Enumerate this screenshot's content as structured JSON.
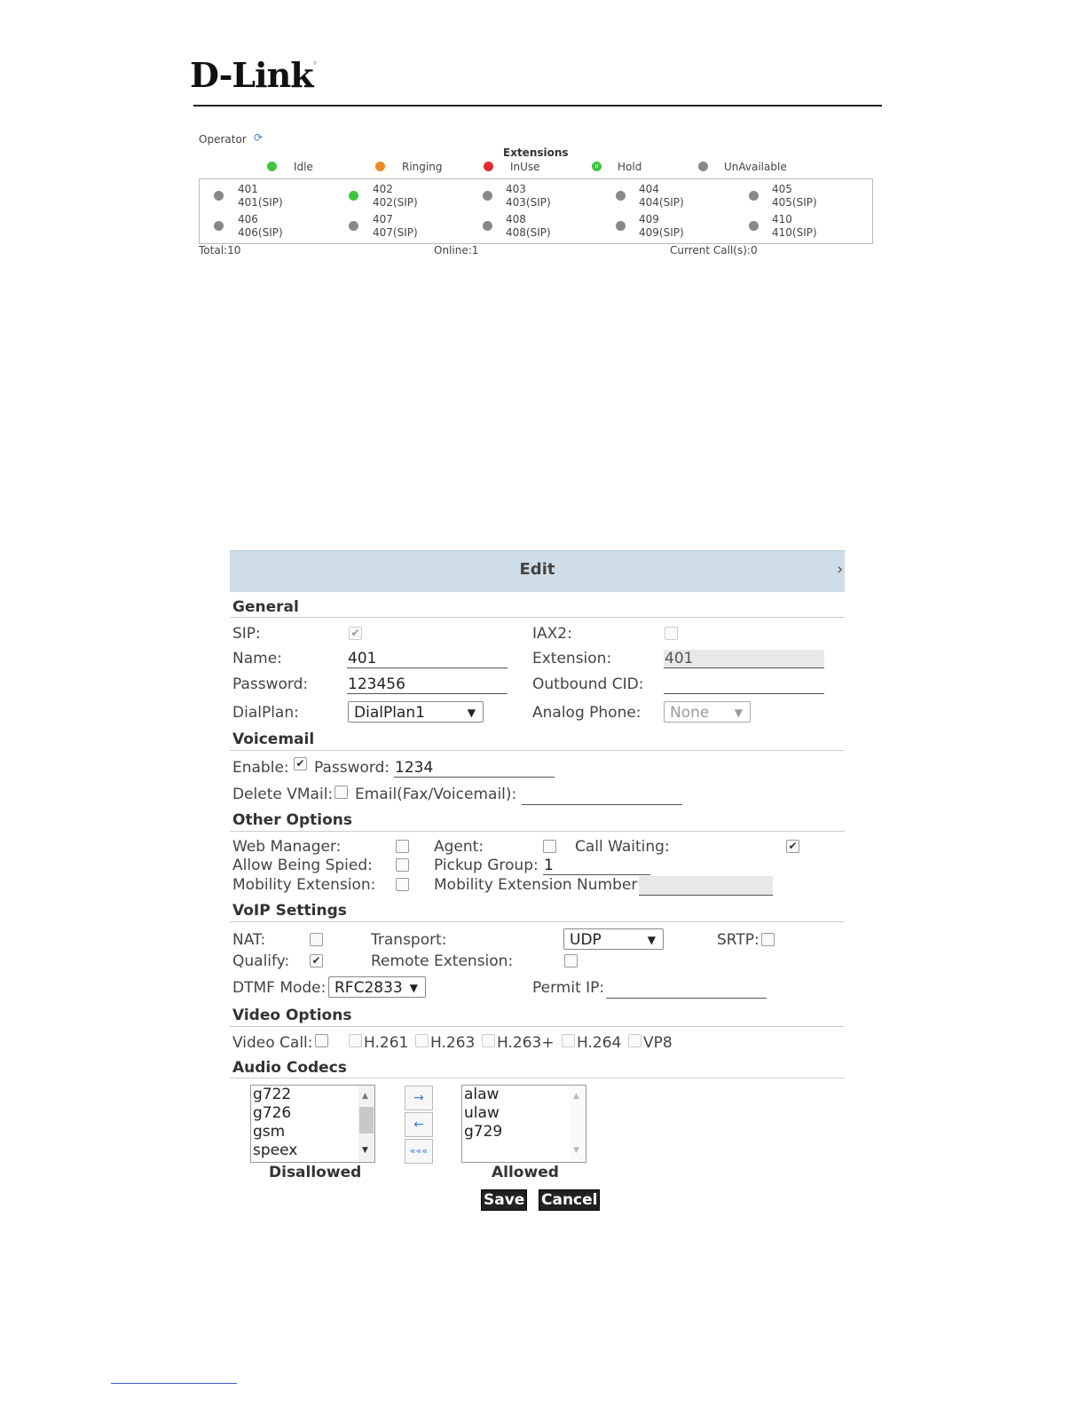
{
  "header": {
    "logo": "D-Link",
    "logo_reg": "®"
  },
  "operator": {
    "label": "Operator",
    "extensions_title": "Extensions",
    "legend": [
      {
        "label": "Idle",
        "color": "#3fc43f"
      },
      {
        "label": "Ringing",
        "color": "#f08a24"
      },
      {
        "label": "InUse",
        "color": "#e02c2c"
      },
      {
        "label": "Hold",
        "color": "#3fc43f"
      },
      {
        "label": "UnAvailable",
        "color": "#888888"
      }
    ],
    "extensions": [
      {
        "num": "401",
        "sip": "401(SIP)",
        "status": "unavailable"
      },
      {
        "num": "402",
        "sip": "402(SIP)",
        "status": "idle"
      },
      {
        "num": "403",
        "sip": "403(SIP)",
        "status": "unavailable"
      },
      {
        "num": "404",
        "sip": "404(SIP)",
        "status": "unavailable"
      },
      {
        "num": "405",
        "sip": "405(SIP)",
        "status": "unavailable"
      },
      {
        "num": "406",
        "sip": "406(SIP)",
        "status": "unavailable"
      },
      {
        "num": "407",
        "sip": "407(SIP)",
        "status": "unavailable"
      },
      {
        "num": "408",
        "sip": "408(SIP)",
        "status": "unavailable"
      },
      {
        "num": "409",
        "sip": "409(SIP)",
        "status": "unavailable"
      },
      {
        "num": "410",
        "sip": "410(SIP)",
        "status": "unavailable"
      }
    ],
    "footer": {
      "total": "Total:10",
      "online": "Online:1",
      "calls": "Current Call(s):0"
    }
  },
  "edit": {
    "title": "Edit",
    "close": "›",
    "general": {
      "heading": "General",
      "sip_label": "SIP:",
      "sip_checked": true,
      "iax2_label": "IAX2:",
      "iax2_checked": false,
      "name_label": "Name:",
      "name_value": "401",
      "extension_label": "Extension:",
      "extension_value": "401",
      "password_label": "Password:",
      "password_value": "123456",
      "outbound_cid_label": "Outbound CID:",
      "outbound_cid_value": "",
      "dialplan_label": "DialPlan:",
      "dialplan_value": "DialPlan1",
      "analog_phone_label": "Analog Phone:",
      "analog_phone_value": "None"
    },
    "voicemail": {
      "heading": "Voicemail",
      "enable_label": "Enable:",
      "enable_checked": true,
      "password_label": "Password:",
      "password_value": "1234",
      "delete_label": "Delete VMail:",
      "delete_checked": false,
      "email_label": "Email(Fax/Voicemail):",
      "email_value": ""
    },
    "other": {
      "heading": "Other Options",
      "web_manager_label": "Web Manager:",
      "agent_label": "Agent:",
      "call_waiting_label": "Call Waiting:",
      "call_waiting_checked": true,
      "allow_spied_label": "Allow Being Spied:",
      "pickup_group_label": "Pickup Group:",
      "pickup_group_value": "1",
      "mobility_ext_label": "Mobility Extension:",
      "mobility_ext_number_label": "Mobility Extension Number:",
      "mobility_ext_number_value": ""
    },
    "voip": {
      "heading": "VoIP Settings",
      "nat_label": "NAT:",
      "transport_label": "Transport:",
      "transport_value": "UDP",
      "srtp_label": "SRTP:",
      "qualify_label": "Qualify:",
      "qualify_checked": true,
      "remote_ext_label": "Remote Extension:",
      "dtmf_label": "DTMF Mode:",
      "dtmf_value": "RFC2833",
      "permit_ip_label": "Permit IP:",
      "permit_ip_value": ""
    },
    "video": {
      "heading": "Video Options",
      "video_call_label": "Video Call:",
      "codecs": [
        "H.261",
        "H.263",
        "H.263+",
        "H.264",
        "VP8"
      ]
    },
    "audio": {
      "heading": "Audio Codecs",
      "disallowed": [
        "g722",
        "g726",
        "gsm",
        "speex"
      ],
      "allowed": [
        "alaw",
        "ulaw",
        "g729"
      ],
      "disallowed_label": "Disallowed",
      "allowed_label": "Allowed",
      "move_right": "→",
      "move_left": "←",
      "move_all_left": "«««"
    },
    "save_label": "Save",
    "cancel_label": "Cancel"
  }
}
